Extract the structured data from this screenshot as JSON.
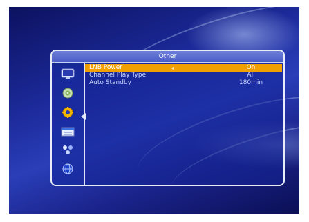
{
  "window": {
    "title": "Other"
  },
  "sidebar": {
    "items": [
      {
        "icon": "tv-icon"
      },
      {
        "icon": "satellite-dish-icon"
      },
      {
        "icon": "gear-icon",
        "selected": true
      },
      {
        "icon": "calendar-icon"
      },
      {
        "icon": "network-icon"
      },
      {
        "icon": "globe-icon"
      }
    ]
  },
  "settings": [
    {
      "label": "LNB Power",
      "value": "On",
      "selected": true
    },
    {
      "label": "Channel Play Type",
      "value": "All"
    },
    {
      "label": "Auto Standby",
      "value": "180min"
    }
  ],
  "colors": {
    "highlight": "#f0a000",
    "panel": "#1424a0",
    "text": "#c9d3ff"
  }
}
